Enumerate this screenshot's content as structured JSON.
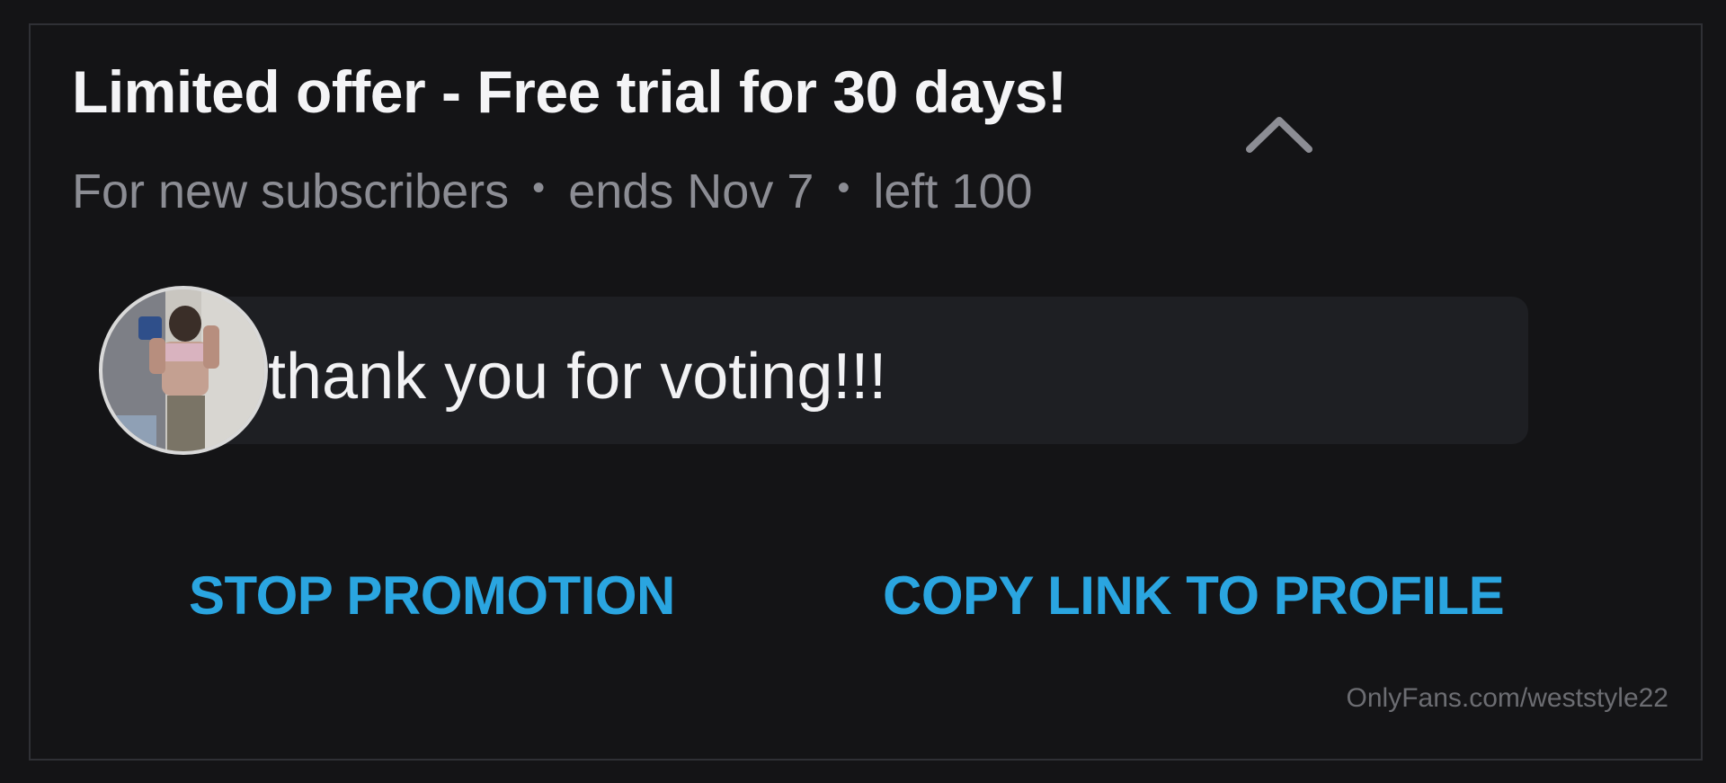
{
  "promo": {
    "title": "Limited offer - Free trial for 30 days!",
    "audience": "For new subscribers",
    "ends": "ends Nov 7",
    "left": "left 100",
    "separator": "•",
    "collapse_icon": "chevron-up-icon"
  },
  "message": {
    "text": "thank you for voting!!!",
    "avatar_icon": "profile-photo"
  },
  "actions": {
    "stop_label": "STOP PROMOTION",
    "copy_label": "COPY LINK TO PROFILE"
  },
  "watermark": "OnlyFans.com/weststyle22",
  "colors": {
    "background": "#141416",
    "accent": "#2aa5e0",
    "title": "#f4f4f6",
    "muted": "#8c8d94",
    "bubble": "#1e1f23"
  }
}
